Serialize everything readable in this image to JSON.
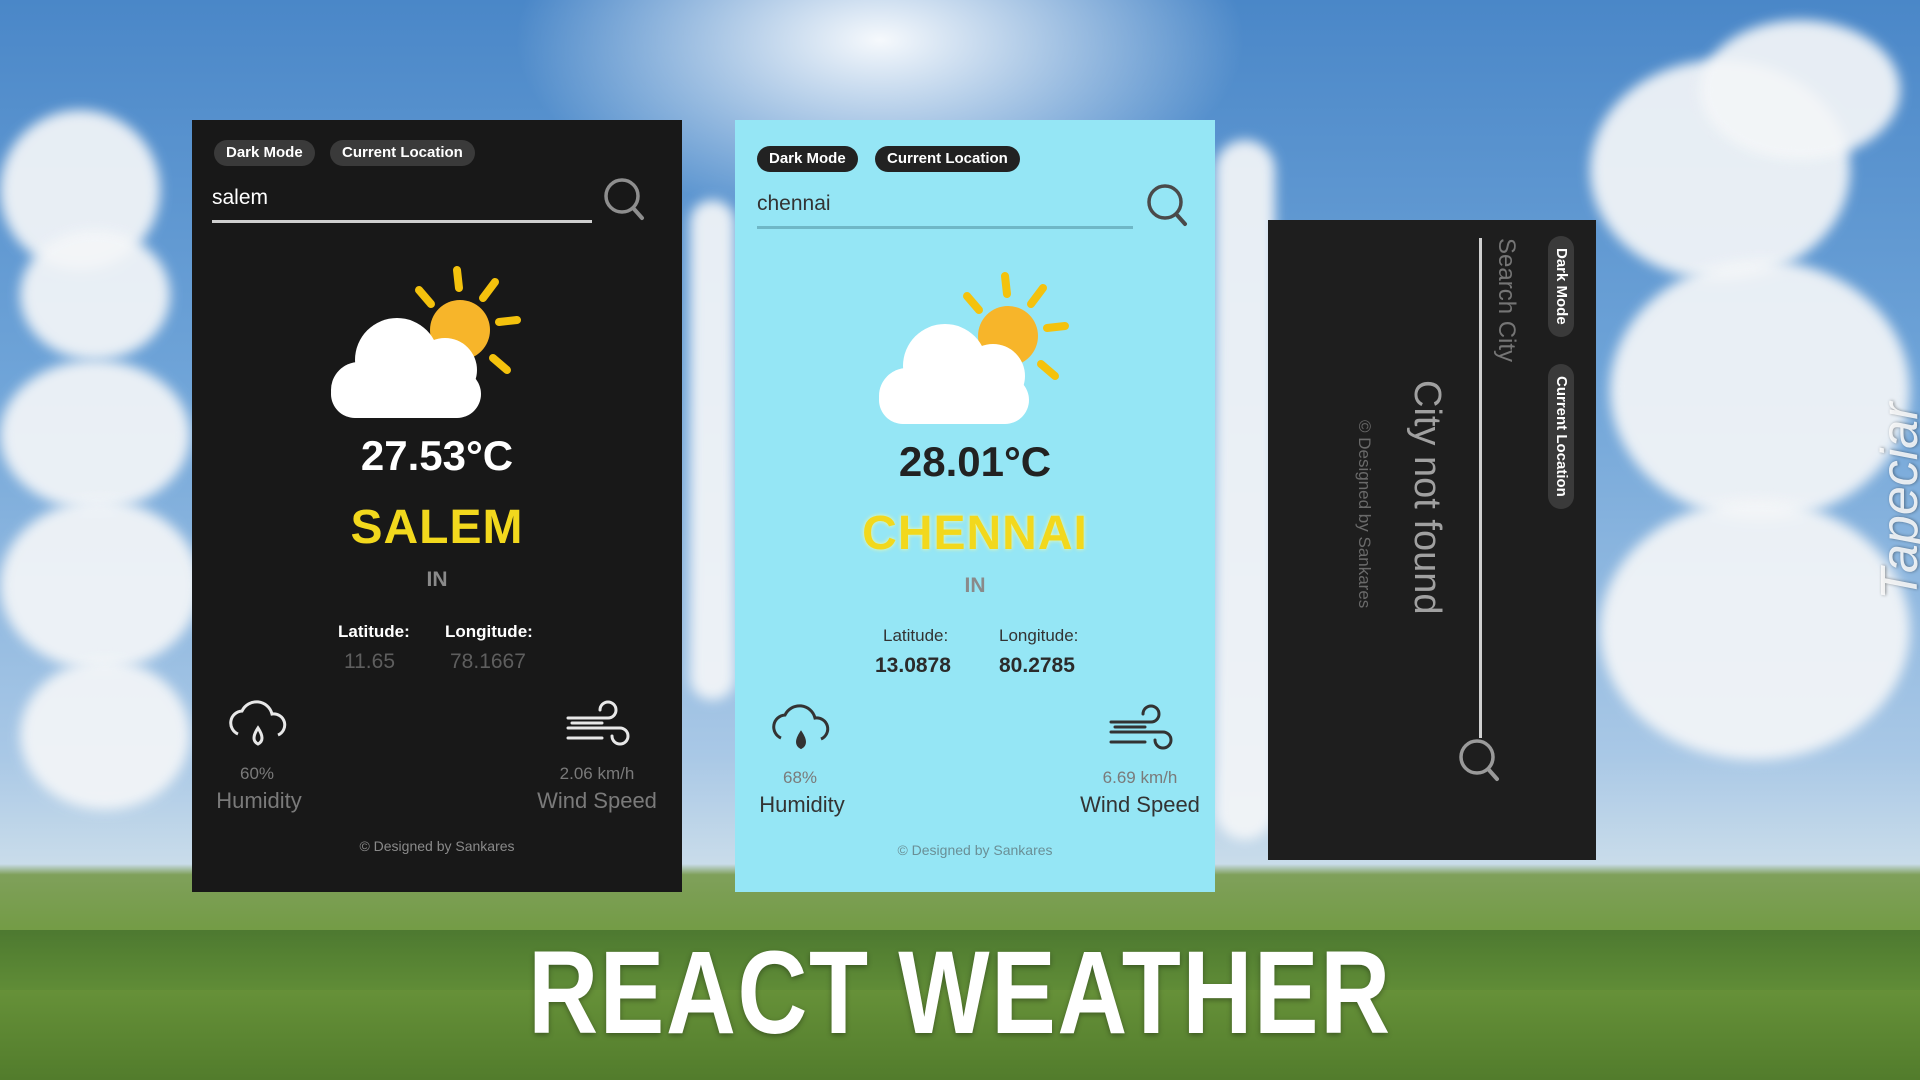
{
  "headline": "REACT WEATHER",
  "watermark": "Tapeciar",
  "colors": {
    "dark_card_bg": "#181818",
    "light_card_bg": "#95e6f5",
    "city_yellow": "#f2d81d",
    "pill_bg": "#3a3a3a"
  },
  "dark_card": {
    "dark_mode_label": "Dark Mode",
    "current_location_label": "Current Location",
    "search_value": "salem",
    "search_icon": "search-icon",
    "weather_icon": "partly-sunny-icon",
    "temperature": "27.53°C",
    "city": "SALEM",
    "country": "IN",
    "latitude_label": "Latitude:",
    "longitude_label": "Longitude:",
    "latitude": "11.65",
    "longitude": "78.1667",
    "humidity_value": "60%",
    "humidity_label": "Humidity",
    "wind_value": "2.06 km/h",
    "wind_label": "Wind Speed",
    "footer": "© Designed by Sankares"
  },
  "light_card": {
    "dark_mode_label": "Dark Mode",
    "current_location_label": "Current Location",
    "search_value": "chennai",
    "search_icon": "search-icon",
    "weather_icon": "partly-sunny-icon",
    "temperature": "28.01°C",
    "city": "CHENNAI",
    "country": "IN",
    "latitude_label": "Latitude:",
    "longitude_label": "Longitude:",
    "latitude": "13.0878",
    "longitude": "80.2785",
    "humidity_value": "68%",
    "humidity_label": "Humidity",
    "wind_value": "6.69 km/h",
    "wind_label": "Wind Speed",
    "footer": "© Designed by Sankares"
  },
  "rotated_card": {
    "dark_mode_label": "Dark Mode",
    "current_location_label": "Current Location",
    "search_placeholder": "Search City",
    "message": "City not found",
    "footer": "© Designed by Sankares"
  }
}
